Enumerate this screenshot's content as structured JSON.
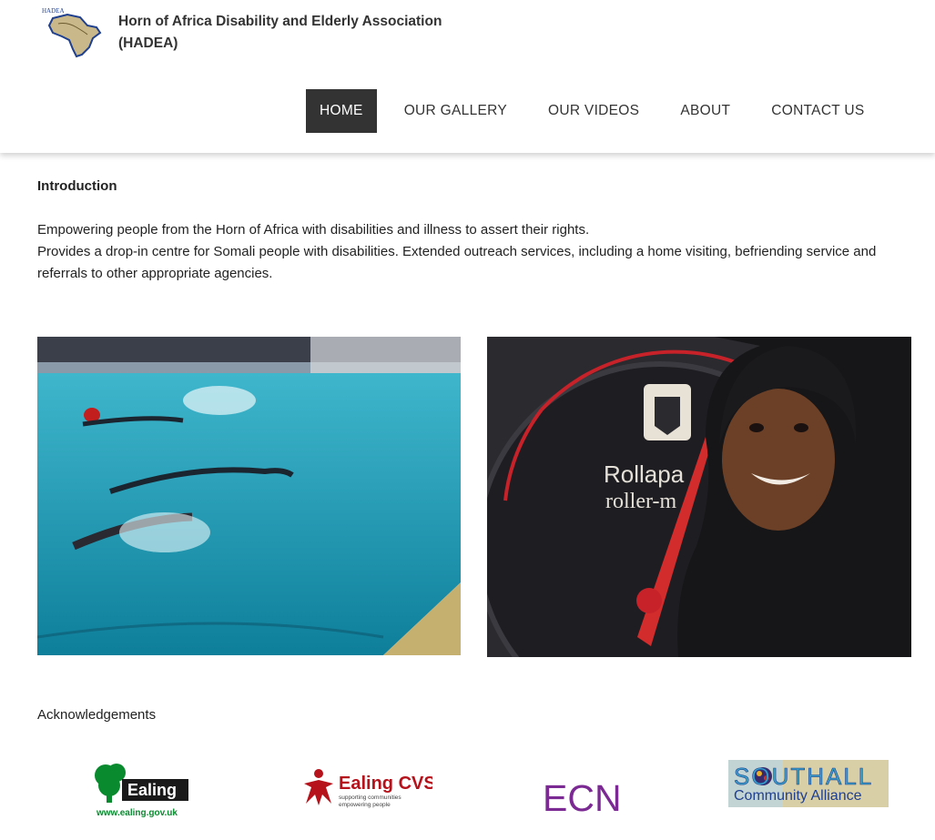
{
  "header": {
    "logo_text": "HADEA",
    "org_name": "Horn of Africa Disability and Elderly Association (HADEA)"
  },
  "nav": [
    {
      "label": "HOME",
      "active": true
    },
    {
      "label": "OUR GALLERY",
      "active": false
    },
    {
      "label": "OUR VIDEOS",
      "active": false
    },
    {
      "label": "ABOUT",
      "active": false
    },
    {
      "label": "CONTACT US",
      "active": false
    }
  ],
  "intro": {
    "title": "Introduction",
    "paragraph1": "Empowering people from the Horn of Africa with disabilities and illness to assert their rights.",
    "paragraph2": "Provides a drop-in centre for Somali people with disabilities. Extended outreach services, including a home visiting, befriending service and referrals to other appropriate agencies."
  },
  "photos": [
    {
      "subject": "swimmers-in-pool"
    },
    {
      "subject": "smiling-woman-with-rollapaddle-scale",
      "scale_text_1": "Rollapa",
      "scale_text_2": "roller-m"
    }
  ],
  "acknowledgements": {
    "title": "Acknowledgements",
    "sponsors": [
      {
        "name": "Ealing",
        "sub": "www.ealing.gov.uk",
        "color": "#0a8a2f"
      },
      {
        "name": "Ealing CVS",
        "sub1": "supporting communities",
        "sub2": "empowering people",
        "color": "#b5121b"
      },
      {
        "name": "ECN",
        "color": "#7b2a93"
      },
      {
        "name": "SOUTHALL",
        "sub": "Community Alliance",
        "color": "#1f3f8f"
      }
    ]
  },
  "colors": {
    "nav_active_bg": "#333333",
    "pool_water": "#1b9bb5"
  }
}
